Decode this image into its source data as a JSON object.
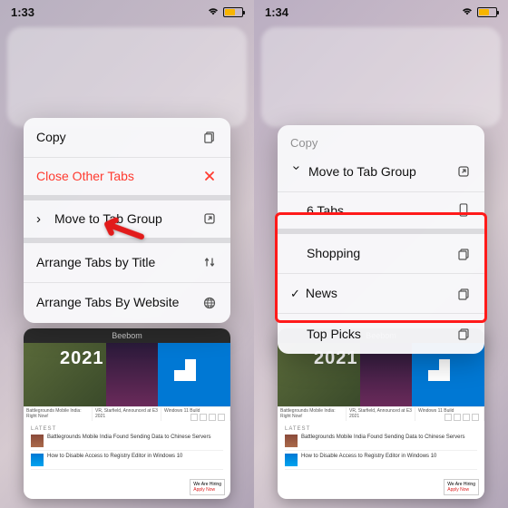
{
  "left": {
    "time": "1:33",
    "menu": {
      "copy": "Copy",
      "close_other": "Close Other Tabs",
      "move_group": "Move to Tab Group",
      "arrange_title": "Arrange Tabs by Title",
      "arrange_site": "Arrange Tabs By Website"
    }
  },
  "right": {
    "time": "1:34",
    "menu": {
      "copy": "Copy",
      "move_group": "Move to Tab Group",
      "six_tabs": "6 Tabs",
      "shopping": "Shopping",
      "news": "News",
      "top_picks": "Top Picks"
    }
  },
  "tab": {
    "site": "Beebom",
    "year": "2021",
    "latest": "LATEST",
    "article1": "Battlegrounds Mobile India Found Sending Data to Chinese Servers",
    "article2": "How to Disable Access to Registry Editor in Windows 10",
    "hiring": "We Are Hiring",
    "apply": "Apply Now"
  }
}
